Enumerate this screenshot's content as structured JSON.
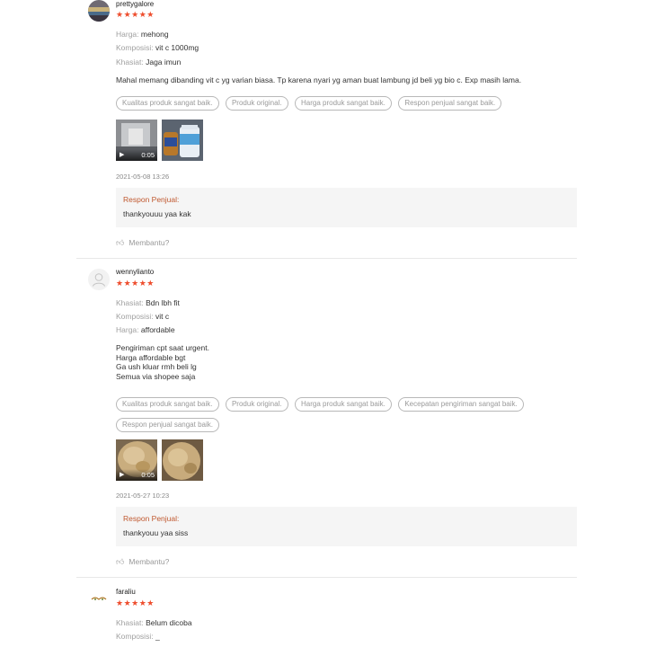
{
  "reviews": [
    {
      "username": "prettygalore",
      "rating_text": "★★★★★",
      "attributes": [
        {
          "label": "Harga:",
          "value": "mehong"
        },
        {
          "label": "Komposisi:",
          "value": "vit c 1000mg"
        },
        {
          "label": "Khasiat:",
          "value": "Jaga imun"
        }
      ],
      "comment": "Mahal memang dibanding vit c yg varian biasa. Tp karena nyari yg aman buat lambung jd beli yg bio c. Exp masih lama.",
      "tags": [
        "Kualitas produk sangat baik.",
        "Produk original.",
        "Harga produk sangat baik.",
        "Respon penjual sangat baik."
      ],
      "media": [
        {
          "type": "video",
          "duration": "0:05"
        },
        {
          "type": "image"
        }
      ],
      "date": "2021-05-08 13:26",
      "seller_response": {
        "title": "Respon Penjual:",
        "text": "thankyouuu yaa kak"
      },
      "helpful_label": "Membantu?"
    },
    {
      "username": "wennylianto",
      "rating_text": "★★★★★",
      "attributes": [
        {
          "label": "Khasiat:",
          "value": "Bdn lbh fit"
        },
        {
          "label": "Komposisi:",
          "value": "vit c"
        },
        {
          "label": "Harga:",
          "value": "affordable"
        }
      ],
      "comment": "Pengiriman cpt saat urgent.\nHarga affordable bgt\nGa ush kluar rmh beli lg\nSemua via shopee saja",
      "tags": [
        "Kualitas produk sangat baik.",
        "Produk original.",
        "Harga produk sangat baik.",
        "Kecepatan pengiriman sangat baik.",
        "Respon penjual sangat baik."
      ],
      "media": [
        {
          "type": "video",
          "duration": "0:05"
        },
        {
          "type": "image"
        }
      ],
      "date": "2021-05-27 10:23",
      "seller_response": {
        "title": "Respon Penjual:",
        "text": "thankyouu yaa siss"
      },
      "helpful_label": "Membantu?"
    },
    {
      "username": "faraliu",
      "rating_text": "★★★★★",
      "attributes": [
        {
          "label": "Khasiat:",
          "value": "Belum dicoba"
        },
        {
          "label": "Komposisi:",
          "value": "_"
        }
      ]
    }
  ]
}
